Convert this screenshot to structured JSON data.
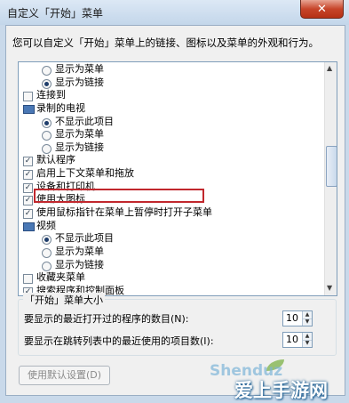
{
  "window": {
    "title": "自定义「开始」菜单",
    "close_glyph": "✕"
  },
  "intro_text": "您可以自定义「开始」菜单上的链接、图标以及菜单的外观和行为。",
  "options": [
    {
      "kind": "radio",
      "level": 2,
      "checked": false,
      "label": "显示为菜单",
      "name": "radio-show-as-menu"
    },
    {
      "kind": "radio",
      "level": 2,
      "checked": true,
      "label": "显示为链接",
      "name": "radio-show-as-link"
    },
    {
      "kind": "check",
      "level": 1,
      "checked": false,
      "label": "连接到",
      "name": "option-connect-to"
    },
    {
      "kind": "tv",
      "level": 1,
      "checked": false,
      "label": "录制的电视",
      "name": "option-recorded-tv",
      "icon": "tv-icon"
    },
    {
      "kind": "radio",
      "level": 2,
      "checked": true,
      "label": "不显示此项目",
      "name": "radio-do-not-show"
    },
    {
      "kind": "radio",
      "level": 2,
      "checked": false,
      "label": "显示为菜单",
      "name": "radio-show-as-menu"
    },
    {
      "kind": "radio",
      "level": 2,
      "checked": false,
      "label": "显示为链接",
      "name": "radio-show-as-link"
    },
    {
      "kind": "check",
      "level": 1,
      "checked": true,
      "label": "默认程序",
      "name": "option-default-programs"
    },
    {
      "kind": "check",
      "level": 1,
      "checked": true,
      "label": "启用上下文菜单和拖放",
      "name": "option-context-menus-drag-drop"
    },
    {
      "kind": "check",
      "level": 1,
      "checked": true,
      "label": "设备和打印机",
      "name": "option-devices-printers"
    },
    {
      "kind": "check",
      "level": 1,
      "checked": true,
      "label": "使用大图标",
      "name": "option-large-icons"
    },
    {
      "kind": "check",
      "level": 1,
      "checked": true,
      "label": "使用鼠标指针在菜单上暂停时打开子菜单",
      "name": "option-open-submenus-on-hover"
    },
    {
      "kind": "tv",
      "level": 1,
      "checked": false,
      "label": "视频",
      "name": "option-videos",
      "icon": "video-icon"
    },
    {
      "kind": "radio",
      "level": 2,
      "checked": true,
      "label": "不显示此项目",
      "name": "radio-do-not-show"
    },
    {
      "kind": "radio",
      "level": 2,
      "checked": false,
      "label": "显示为菜单",
      "name": "radio-show-as-menu"
    },
    {
      "kind": "radio",
      "level": 2,
      "checked": false,
      "label": "显示为链接",
      "name": "radio-show-as-link"
    },
    {
      "kind": "check",
      "level": 1,
      "checked": false,
      "label": "收藏夹菜单",
      "name": "option-favorites-menu"
    },
    {
      "kind": "check",
      "level": 1,
      "checked": true,
      "label": "搜索程序和控制面板",
      "name": "option-search-programs-control-panel"
    }
  ],
  "highlight_color": "#c1272d",
  "size_group": {
    "title": "「开始」菜单大小",
    "recent_programs_label": "要显示的最近打开过的程序的数目(N):",
    "recent_programs_value": "10",
    "jump_list_label": "要显示在跳转列表中的最近使用的项目数(I):",
    "jump_list_value": "10"
  },
  "buttons": {
    "use_default": "使用默认设置(D)"
  },
  "watermark": {
    "en": "Shenduz",
    "cn": "爱上手游网"
  }
}
